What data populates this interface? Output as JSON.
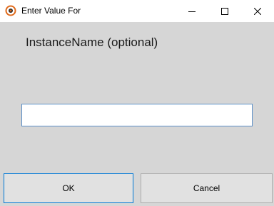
{
  "window": {
    "title": "Enter Value For",
    "icon": "target-ring-icon",
    "controls": [
      "minimize-icon",
      "maximize-icon",
      "close-icon"
    ]
  },
  "dialog": {
    "prompt": "InstanceName (optional)",
    "input_value": "",
    "input_placeholder": "",
    "ok_label": "OK",
    "cancel_label": "Cancel"
  },
  "colors": {
    "background": "#d6d6d6",
    "titlebar": "#ffffff",
    "icon_accent": "#e06a1b",
    "focus_border": "#0078d7"
  }
}
